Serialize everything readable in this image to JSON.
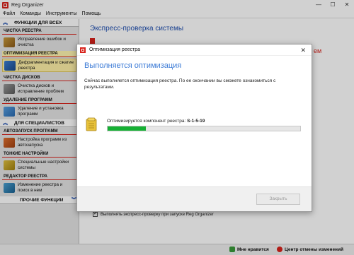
{
  "window": {
    "title": "Reg Organizer",
    "controls": {
      "minimize": "—",
      "maximize": "☐",
      "close": "✕"
    }
  },
  "menu": [
    "Файл",
    "Команды",
    "Инструменты",
    "Помощь"
  ],
  "sidebar": {
    "header_all": "ФУНКЦИИ ДЛЯ ВСЕХ",
    "groups_all": [
      {
        "title": "ЧИСТКА РЕЕСТРА",
        "item": "Исправление ошибок и очистка",
        "selected": false,
        "icon": "broom-icon"
      },
      {
        "title": "ОПТИМИЗАЦИЯ РЕЕСТРА",
        "item": "Дефрагментация и сжатие реестра",
        "selected": true,
        "icon": "registry-optimize-icon"
      },
      {
        "title": "ЧИСТКА ДИСКОВ",
        "item": "Очистка дисков и исправление проблем",
        "selected": false,
        "icon": "disk-clean-icon"
      },
      {
        "title": "УДАЛЕНИЕ ПРОГРАММ",
        "item": "Удаление и установка программ",
        "selected": false,
        "icon": "uninstall-icon"
      }
    ],
    "header_pro": "ДЛЯ СПЕЦИАЛИСТОВ",
    "groups_pro": [
      {
        "title": "АВТОЗАПУСК ПРОГРАММ",
        "item": "Настройка программ из автозапуска",
        "icon": "autorun-icon"
      },
      {
        "title": "ТОНКИЕ НАСТРОЙКИ",
        "item": "Специальные настройки системы",
        "icon": "tweaks-icon"
      },
      {
        "title": "РЕДАКТОР РЕЕСТРА",
        "item": "Изменение реестра и поиск в нем",
        "icon": "regedit-icon"
      }
    ],
    "header_other": "ПРОЧИЕ ФУНКЦИИ"
  },
  "main": {
    "title": "Экспресс-проверка системы",
    "bg_fragment": "ем",
    "checkbox_label": "Выполнять экспресс-проверку при запуске Reg Organizer"
  },
  "statusbar": {
    "like": "Мне нравится",
    "undo_center": "Центр отмены изменений"
  },
  "dialog": {
    "title": "Оптимизация реестра",
    "heading": "Выполняется оптимизация",
    "description": "Сейчас выполняется оптимизация реестра. По ее окончании вы сможете ознакомиться с результатами.",
    "progress_prefix": "Оптимизируется компонент реестра: ",
    "progress_component": "S-1-5-19",
    "progress_fraction": 0.2,
    "close_button": "Закрыть",
    "close_icon": "✕"
  },
  "colors": {
    "accent_blue": "#1f4fb0",
    "heading_blue": "#3c7bd6",
    "brand_red": "#d8231c",
    "progress_green": "#16b034",
    "selected_yellow": "#fff1a8"
  }
}
